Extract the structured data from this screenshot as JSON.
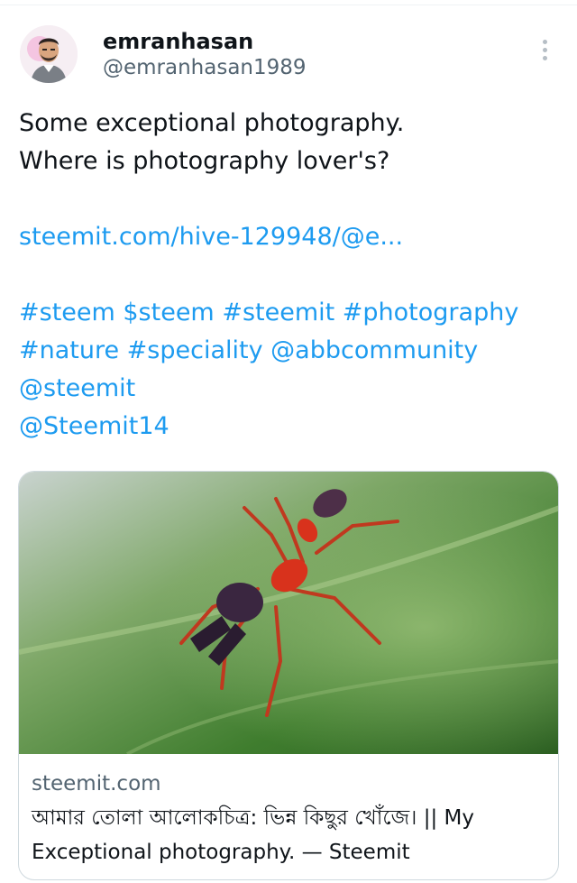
{
  "author": {
    "display_name": "emranhasan",
    "handle": "@emranhasan1989",
    "avatar_icon": "profile-photo"
  },
  "more_icon": "more-vertical-icon",
  "tweet": {
    "text_lines": [
      "Some exceptional photography.",
      "Where is photography lover's?"
    ],
    "link": "steemit.com/hive-129948/@e...",
    "tag_lines": [
      "#steem $steem #steemit #photography",
      "#nature #speciality @abbcommunity",
      "@steemit",
      "@Steemit14"
    ]
  },
  "card": {
    "image_description_icon": "spider-macro-photo",
    "domain": "steemit.com",
    "title_line1": "আমার তোলা আলোকচিত্র: ভিন্ন কিছুর খোঁজে। || My",
    "title_line2": "Exceptional photography. — Steemit"
  },
  "colors": {
    "link": "#1d9bf0",
    "secondary_text": "#536471",
    "border": "#cfd9de"
  }
}
